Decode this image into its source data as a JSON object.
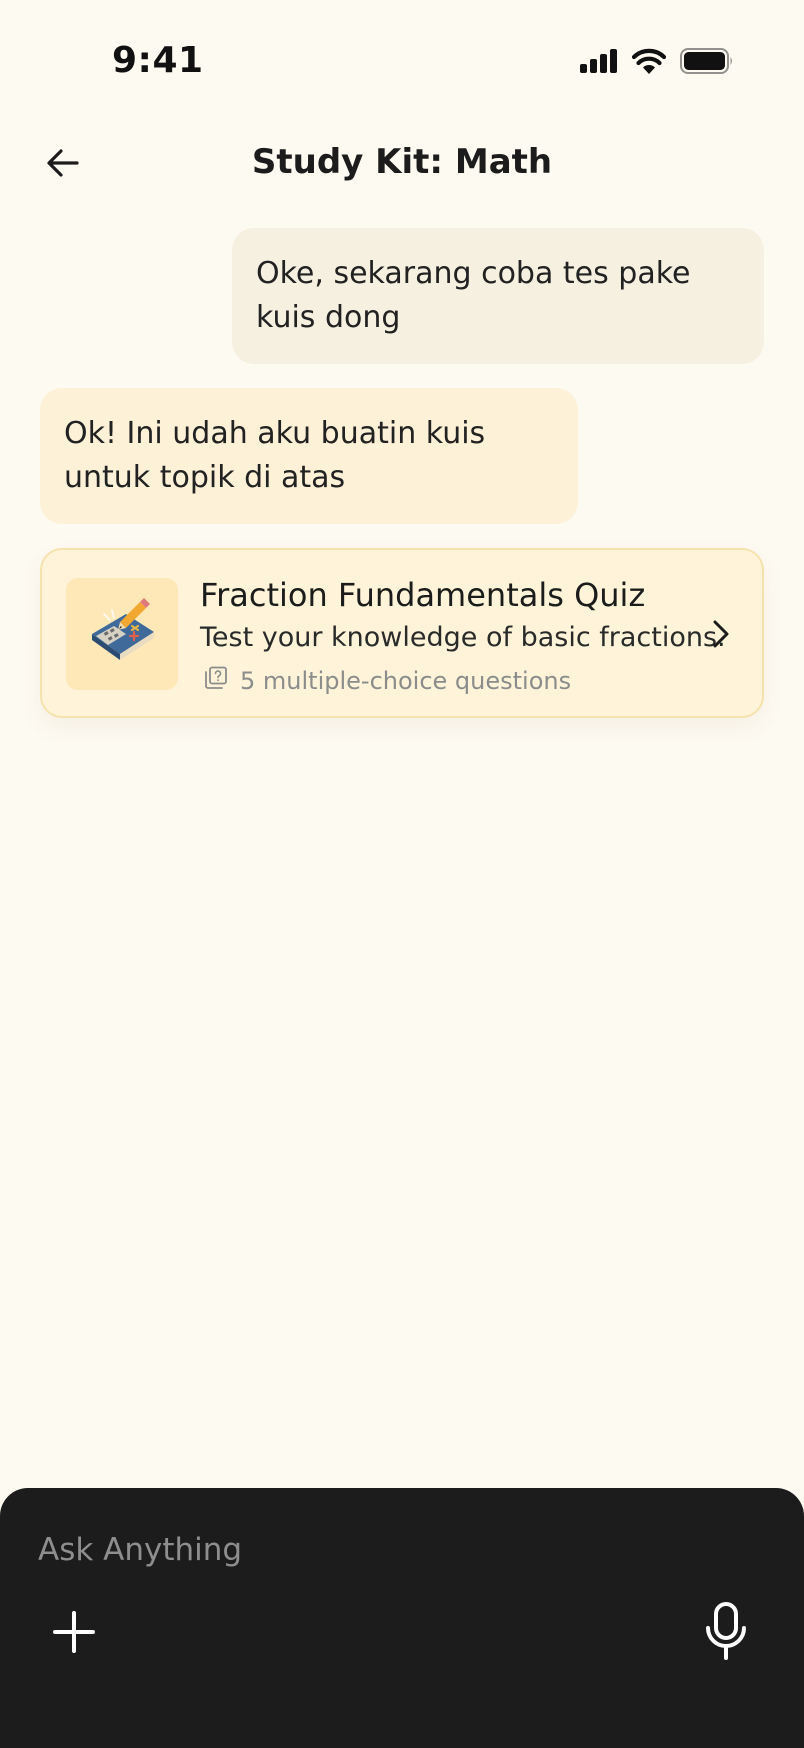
{
  "status_bar": {
    "time": "9:41",
    "icons": [
      "cellular-signal-icon",
      "wifi-icon",
      "battery-icon"
    ]
  },
  "header": {
    "title": "Study Kit: Math",
    "back_icon": "arrow-left-icon"
  },
  "messages": [
    {
      "role": "user",
      "text": "Oke, sekarang coba tes pake kuis dong"
    },
    {
      "role": "assistant",
      "text": "Ok! Ini udah aku buatin kuis untuk topik di atas"
    }
  ],
  "quiz_card": {
    "title": "Fraction Fundamentals Quiz",
    "description": "Test your knowledge of basic fractions.",
    "meta": "5 multiple-choice questions",
    "meta_icon": "question-cards-icon",
    "thumbnail_icon": "math-book-calculator-icon",
    "chevron_icon": "chevron-right-icon"
  },
  "composer": {
    "placeholder": "Ask Anything",
    "value": "",
    "add_icon": "plus-icon",
    "mic_icon": "microphone-icon"
  },
  "colors": {
    "background": "#fdfaf2",
    "user_bubble": "#f6f0e0",
    "assistant_bubble": "#fdf1d8",
    "quiz_card": "#fff4d9",
    "quiz_card_border": "#f6e2ad",
    "composer_background": "#1c1c1c"
  }
}
